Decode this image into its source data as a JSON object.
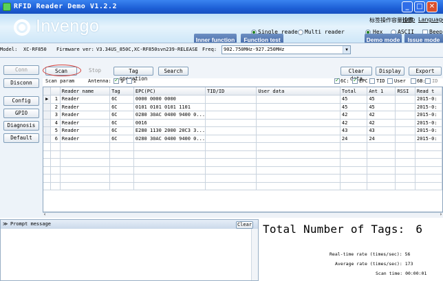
{
  "window": {
    "title": "RFID Reader Demo V1.2.2"
  },
  "header": {
    "brand": "Invengo",
    "settings_menu": "标签操作容量设置",
    "help_menu": "Help",
    "language_menu": "Language",
    "reader_mode": {
      "single": "Single reader",
      "multi": "Multi reader",
      "selected": "single"
    },
    "format": {
      "hex": "Hex",
      "ascii": "ASCII",
      "selected": "hex"
    },
    "beep_label": "Beep",
    "nav": {
      "inner_function": "Inner function",
      "function_test": "Function test",
      "demo_mode": "Demo mode",
      "issue_mode": "Issue mode"
    }
  },
  "model_bar": {
    "model_label": "Model:",
    "model_value": "XC-RF850",
    "firmware_label": "Firmware ver:",
    "firmware_value": "V3.34US_850C,XC-RF850svn239-RELEASE",
    "freq_label": "Freq:",
    "freq_value": "902.750MHz-927.250MHz"
  },
  "left_panel": {
    "conn": "Conn",
    "disconn": "Disconn",
    "config": "Config",
    "gpio": "GPIO",
    "diagnosis": "Diagnosis",
    "default": "Default"
  },
  "toolbar": {
    "scan": "Scan",
    "stop": "Stop",
    "tag_operation": "Tag operation",
    "search": "Search",
    "clear_data": "Clear data",
    "display": "Display",
    "export": "Export",
    "scan_param": "Scan param",
    "antenna_label": "Antenna:",
    "antenna1": "1",
    "antenna2": "2",
    "filter_6c": "6C:",
    "filter_epc": "EPC",
    "filter_tid": "TID",
    "filter_user": "User",
    "filter_6b": "6B:",
    "filter_id": "ID",
    "filter_user2": "User"
  },
  "grid": {
    "columns": [
      "Reader name",
      "Tag",
      "EPC(PC)",
      "TID/ID",
      "User data",
      "Total",
      "Ant 1",
      "RSSI",
      "Read t"
    ],
    "rows": [
      {
        "no": "1",
        "reader": "Reader",
        "tag": "6C",
        "epc": "0000 0000 0000",
        "tid": "",
        "user": "",
        "total": "45",
        "ant1": "45",
        "rssi": "",
        "read": "2015-0:"
      },
      {
        "no": "2",
        "reader": "Reader",
        "tag": "6C",
        "epc": "0101 0101 0101 1101",
        "tid": "",
        "user": "",
        "total": "45",
        "ant1": "45",
        "rssi": "",
        "read": "2015-0:"
      },
      {
        "no": "3",
        "reader": "Reader",
        "tag": "6C",
        "epc": "0280 30AC 0400 9400 0...",
        "tid": "",
        "user": "",
        "total": "42",
        "ant1": "42",
        "rssi": "",
        "read": "2015-0:"
      },
      {
        "no": "4",
        "reader": "Reader",
        "tag": "6C",
        "epc": "0016",
        "tid": "",
        "user": "",
        "total": "42",
        "ant1": "42",
        "rssi": "",
        "read": "2015-0:"
      },
      {
        "no": "5",
        "reader": "Reader",
        "tag": "6C",
        "epc": "E280 1130 2000 20C3 3...",
        "tid": "",
        "user": "",
        "total": "43",
        "ant1": "43",
        "rssi": "",
        "read": "2015-0:"
      },
      {
        "no": "6",
        "reader": "Reader",
        "tag": "6C",
        "epc": "0280 30AC 0400 9400 0...",
        "tid": "",
        "user": "",
        "total": "24",
        "ant1": "24",
        "rssi": "",
        "read": "2015-0:"
      }
    ]
  },
  "prompt": {
    "title": "Prompt message",
    "clear": "Clear"
  },
  "stats": {
    "total_label": "Total Number of Tags:",
    "total_value": "6",
    "realtime_label": "Real-time rate (times/sec):",
    "realtime_value": "56",
    "average_label": "Average rate (times/sec):",
    "average_value": "173",
    "scan_time_label": "Scan time:",
    "scan_time_value": "00:00:01"
  },
  "colors": {
    "titlebar": "#1d5fd6",
    "nav_button": "#4a70ad",
    "header_band": "#cfe7f8",
    "scan_highlight": "#d6403a"
  }
}
